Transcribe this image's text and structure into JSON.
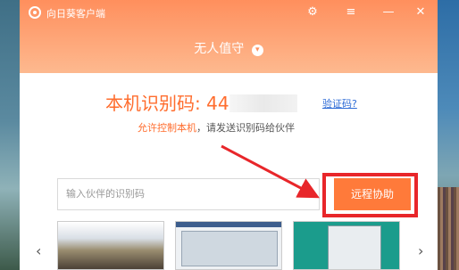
{
  "app": {
    "title": "向日葵客户端",
    "mode_label": "无人值守",
    "mode_icon": "chevron-down-icon"
  },
  "titlebar": {
    "settings_icon": "⚙",
    "menu_icon": "≡",
    "minimize_icon": "—",
    "close_icon": "✕"
  },
  "identity": {
    "label": "本机识别码: 44",
    "verify_link": "验证码?"
  },
  "hint": {
    "allow_text": "允许控制本机",
    "rest_text": "，请发送识别码给伙伴"
  },
  "partner": {
    "placeholder": "输入伙伴的识别码",
    "remote_button": "远程协助"
  },
  "thumbnails": {
    "prev_icon": "‹",
    "next_icon": "›"
  },
  "colors": {
    "accent": "#ff7a3a",
    "highlight": "#e8262a",
    "link": "#2d6bd6"
  }
}
